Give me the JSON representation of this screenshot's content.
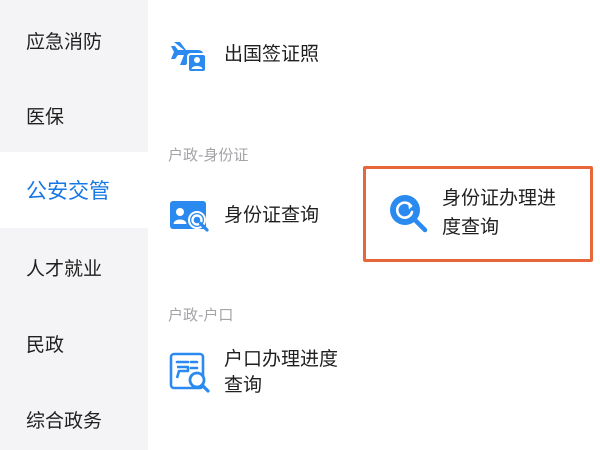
{
  "sidebar": {
    "items": [
      {
        "label": "应急消防",
        "active": false
      },
      {
        "label": "医保",
        "active": false
      },
      {
        "label": "公安交管",
        "active": true
      },
      {
        "label": "人才就业",
        "active": false
      },
      {
        "label": "民政",
        "active": false
      },
      {
        "label": "综合政务",
        "active": false
      }
    ]
  },
  "main": {
    "top_service": {
      "label": "出国签证照",
      "icon": "airplane-person-icon"
    },
    "sections": [
      {
        "title": "户政-身份证",
        "services": [
          {
            "label": "身份证查询",
            "icon": "id-card-search-icon"
          },
          {
            "label": "身份证办理进度查询",
            "line1": "身份证办理进",
            "line2": "度查询",
            "icon": "refresh-search-icon",
            "highlighted": true
          }
        ]
      },
      {
        "title": "户政-户口",
        "services": [
          {
            "label": "户口办理进度查询",
            "line1": "户口办理进度",
            "line2": "查询",
            "icon": "household-register-search-icon"
          }
        ]
      }
    ]
  },
  "colors": {
    "accent": "#1677e5",
    "icon_blue": "#2a8af0",
    "sidebar_bg": "#f4f4f6",
    "highlight_border": "#e8673a"
  }
}
